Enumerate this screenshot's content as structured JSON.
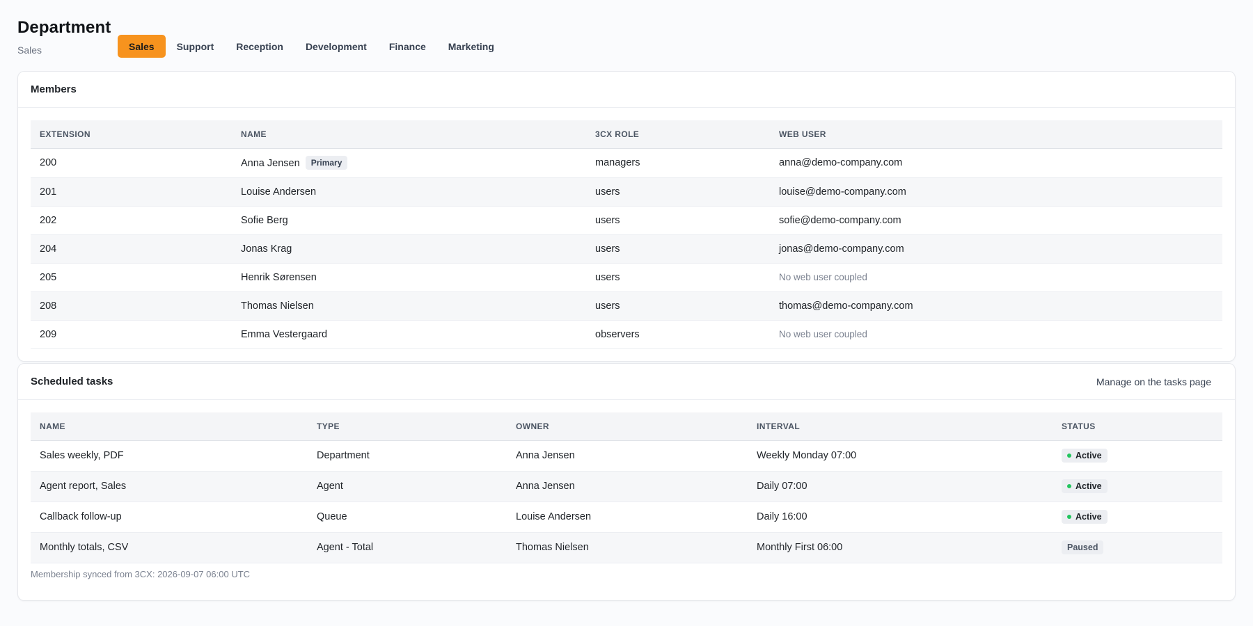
{
  "header": {
    "title": "Department",
    "subtitle": "Sales"
  },
  "tabs": [
    {
      "label": "Sales",
      "active": true
    },
    {
      "label": "Support",
      "active": false
    },
    {
      "label": "Reception",
      "active": false
    },
    {
      "label": "Development",
      "active": false
    },
    {
      "label": "Finance",
      "active": false
    },
    {
      "label": "Marketing",
      "active": false
    }
  ],
  "members": {
    "title": "Members",
    "columns": [
      "EXTENSION",
      "NAME",
      "3CX ROLE",
      "WEB USER"
    ],
    "primary_badge": "Primary",
    "rows": [
      {
        "extension": "200",
        "name": "Anna Jensen",
        "primary": true,
        "role": "managers",
        "web_user": "anna@demo-company.com",
        "coupled": true
      },
      {
        "extension": "201",
        "name": "Louise Andersen",
        "primary": false,
        "role": "users",
        "web_user": "louise@demo-company.com",
        "coupled": true
      },
      {
        "extension": "202",
        "name": "Sofie Berg",
        "primary": false,
        "role": "users",
        "web_user": "sofie@demo-company.com",
        "coupled": true
      },
      {
        "extension": "204",
        "name": "Jonas Krag",
        "primary": false,
        "role": "users",
        "web_user": "jonas@demo-company.com",
        "coupled": true
      },
      {
        "extension": "205",
        "name": "Henrik Sørensen",
        "primary": false,
        "role": "users",
        "web_user": "No web user coupled",
        "coupled": false
      },
      {
        "extension": "208",
        "name": "Thomas Nielsen",
        "primary": false,
        "role": "users",
        "web_user": "thomas@demo-company.com",
        "coupled": true
      },
      {
        "extension": "209",
        "name": "Emma Vestergaard",
        "primary": false,
        "role": "observers",
        "web_user": "No web user coupled",
        "coupled": false
      }
    ]
  },
  "tasks": {
    "title": "Scheduled tasks",
    "manage_link": "Manage on the tasks page",
    "columns": [
      "NAME",
      "TYPE",
      "OWNER",
      "INTERVAL",
      "STATUS"
    ],
    "rows": [
      {
        "name": "Sales weekly, PDF",
        "type": "Department",
        "owner": "Anna Jensen",
        "interval": "Weekly Monday 07:00",
        "status": "Active"
      },
      {
        "name": "Agent report, Sales",
        "type": "Agent",
        "owner": "Anna Jensen",
        "interval": "Daily 07:00",
        "status": "Active"
      },
      {
        "name": "Callback follow-up",
        "type": "Queue",
        "owner": "Louise Andersen",
        "interval": "Daily 16:00",
        "status": "Active"
      },
      {
        "name": "Monthly totals, CSV",
        "type": "Agent - Total",
        "owner": "Thomas Nielsen",
        "interval": "Monthly First 06:00",
        "status": "Paused"
      }
    ],
    "footnote": "Membership synced from 3CX: 2026-09-07 06:00 UTC"
  },
  "colors": {
    "accent": "#f7931e",
    "active_dot": "#22c55e"
  }
}
